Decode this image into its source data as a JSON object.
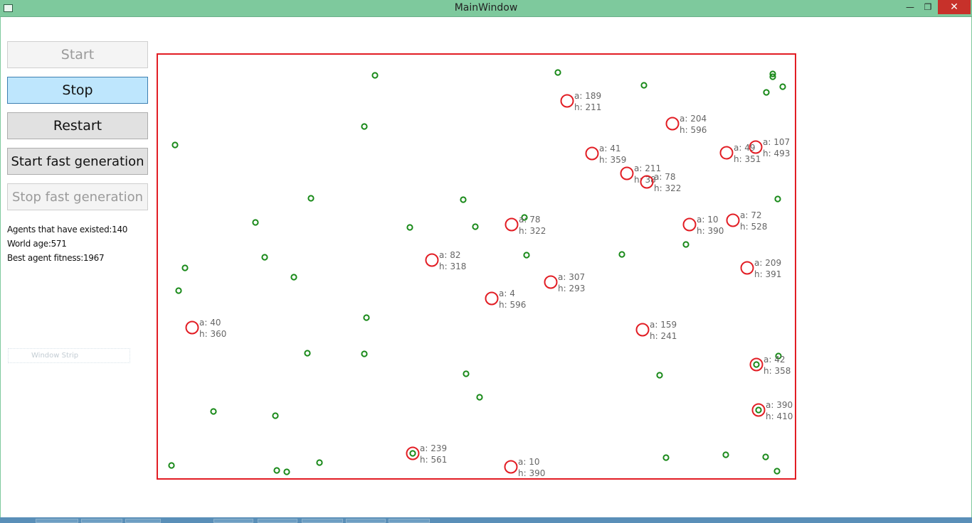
{
  "window": {
    "title": "MainWindow",
    "minimize_glyph": "—",
    "maximize_glyph": "❐",
    "close_glyph": "✕"
  },
  "controls": {
    "start_label": "Start",
    "stop_label": "Stop",
    "restart_label": "Restart",
    "start_fast_label": "Start fast generation",
    "stop_fast_label": "Stop fast generation"
  },
  "stats": {
    "agents_text": "Agents that have existed:140",
    "world_age_text": "World age:571",
    "best_fitness_text": "Best agent fitness:1967"
  },
  "window_strip_label": "Window Strip",
  "colors": {
    "food": "#1a8a1a",
    "agent": "#e21d24",
    "agent_label": "#666666",
    "world_border": "#e21d24",
    "titlebar": "#7ec99d"
  },
  "world": {
    "food": [
      {
        "id": "f1"
      },
      {
        "id": "f2"
      },
      {
        "id": "f3"
      },
      {
        "id": "f4"
      },
      {
        "id": "f5"
      },
      {
        "id": "f6"
      },
      {
        "id": "f7"
      },
      {
        "id": "f8"
      },
      {
        "id": "f9"
      },
      {
        "id": "f10"
      },
      {
        "id": "f11"
      },
      {
        "id": "f12"
      },
      {
        "id": "f13"
      },
      {
        "id": "f14"
      },
      {
        "id": "f15"
      },
      {
        "id": "f16"
      },
      {
        "id": "f17"
      },
      {
        "id": "f18"
      },
      {
        "id": "f19"
      },
      {
        "id": "f20"
      },
      {
        "id": "f21"
      },
      {
        "id": "f22"
      },
      {
        "id": "f23"
      },
      {
        "id": "f24"
      },
      {
        "id": "f25"
      },
      {
        "id": "f26"
      },
      {
        "id": "f27"
      },
      {
        "id": "f28"
      },
      {
        "id": "f29"
      },
      {
        "id": "f30"
      },
      {
        "id": "f31"
      },
      {
        "id": "f32"
      },
      {
        "id": "f33"
      },
      {
        "id": "f34"
      },
      {
        "id": "f35"
      },
      {
        "id": "f36"
      },
      {
        "id": "f37"
      },
      {
        "id": "f38"
      },
      {
        "id": "f39"
      },
      {
        "id": "f40"
      },
      {
        "id": "f41"
      },
      {
        "id": "f42"
      },
      {
        "id": "f43"
      }
    ],
    "agents": [
      {
        "a": "a: 189",
        "h": "h: 211"
      },
      {
        "a": "a: 204",
        "h": "h: 596"
      },
      {
        "a": "a: 41",
        "h": "h: 359"
      },
      {
        "a": "a: 49",
        "h": "h: 351"
      },
      {
        "a": "a: 107",
        "h": "h: 493"
      },
      {
        "a": "a: 211",
        "h": "h: 38"
      },
      {
        "a": "a: 78",
        "h": "h: 322"
      },
      {
        "a": "a: 78",
        "h": "h: 322"
      },
      {
        "a": "a: 10",
        "h": "h: 390"
      },
      {
        "a": "a: 72",
        "h": "h: 528"
      },
      {
        "a": "a: 82",
        "h": "h: 318"
      },
      {
        "a": "a: 209",
        "h": "h: 391"
      },
      {
        "a": "a: 307",
        "h": "h: 293"
      },
      {
        "a": "a: 4",
        "h": "h: 596"
      },
      {
        "a": "a: 40",
        "h": "h: 360"
      },
      {
        "a": "a: 159",
        "h": "h: 241"
      },
      {
        "a": "a: 42",
        "h": "h: 358"
      },
      {
        "a": "a: 390",
        "h": "h: 410"
      },
      {
        "a": "a: 239",
        "h": "h: 561"
      },
      {
        "a": "a: 10",
        "h": "h: 390"
      }
    ]
  }
}
